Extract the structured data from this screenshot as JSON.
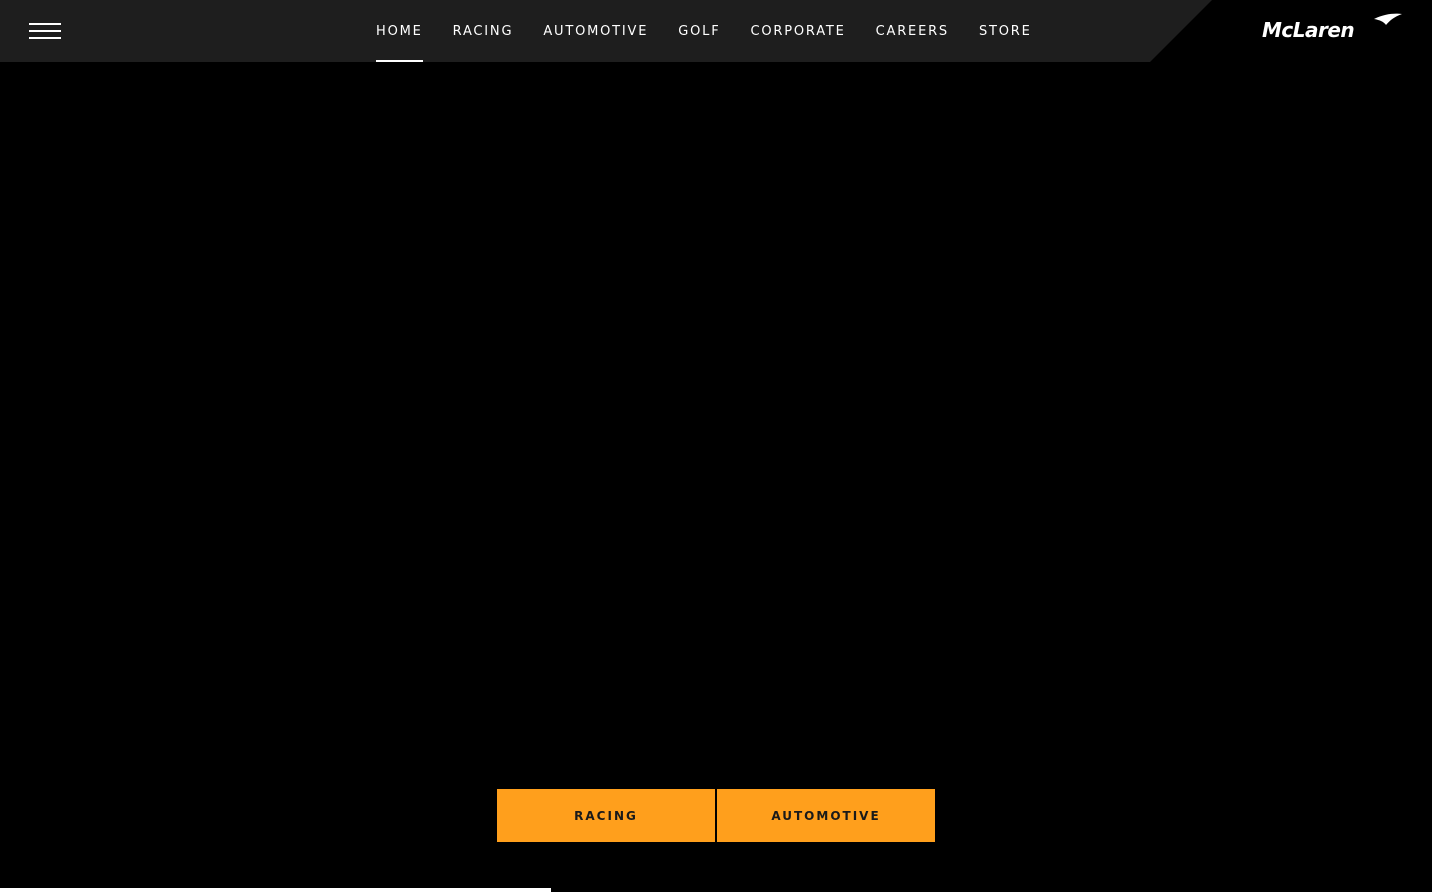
{
  "header": {
    "menu_icon": "hamburger-menu-icon",
    "nav_items": [
      {
        "label": "HOME",
        "active": true
      },
      {
        "label": "RACING",
        "active": false
      },
      {
        "label": "AUTOMOTIVE",
        "active": false
      },
      {
        "label": "GOLF",
        "active": false
      },
      {
        "label": "CORPORATE",
        "active": false
      },
      {
        "label": "CAREERS",
        "active": false
      },
      {
        "label": "STORE",
        "active": false
      }
    ],
    "logo_text": "McLaren"
  },
  "hero": {
    "buttons": [
      {
        "label": "RACING"
      },
      {
        "label": "AUTOMOTIVE"
      }
    ],
    "slide_progress": 0.385
  },
  "colors": {
    "background": "#000000",
    "header": "#1e1e1e",
    "accent": "#ff9f1c",
    "text": "#ffffff"
  }
}
